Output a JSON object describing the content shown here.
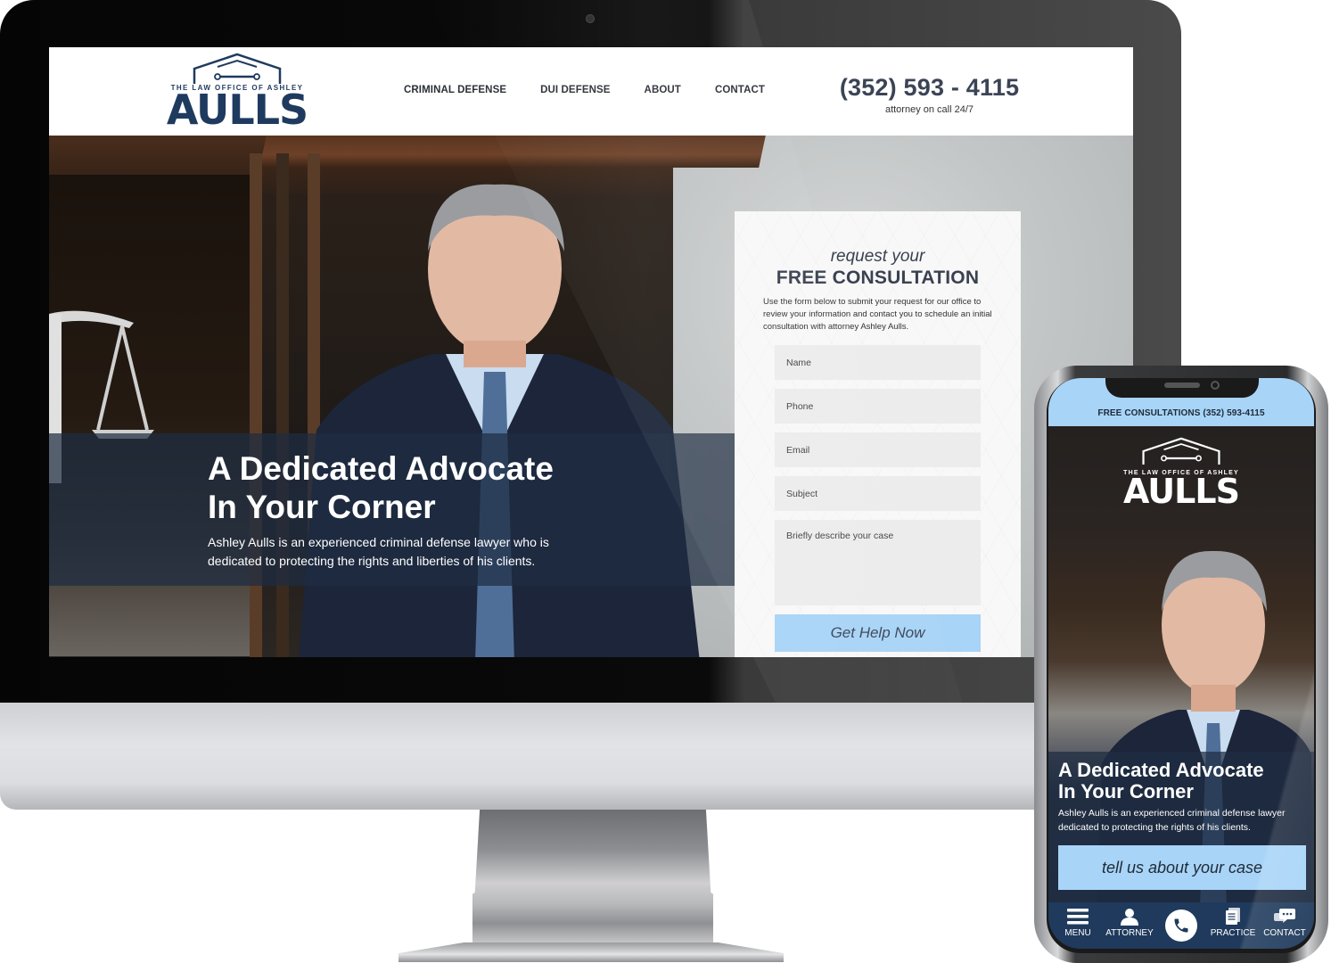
{
  "desktop": {
    "logo": {
      "tagline": "THE LAW OFFICE OF ASHLEY",
      "name": "AULLS"
    },
    "nav": [
      {
        "label": "CRIMINAL DEFENSE"
      },
      {
        "label": "DUI DEFENSE"
      },
      {
        "label": "ABOUT"
      },
      {
        "label": "CONTACT"
      }
    ],
    "phone": {
      "number": "(352) 593 - 4115",
      "subtitle": "attorney on call 24/7"
    },
    "hero": {
      "title_line1": "A Dedicated Advocate",
      "title_line2": "In Your Corner",
      "text": "Ashley Aulls is an experienced criminal defense lawyer who is dedicated to protecting the rights and liberties of his clients."
    },
    "form": {
      "kicker": "request your",
      "title": "FREE CONSULTATION",
      "description": "Use the form below to submit your request for our office to review your information and contact you to schedule an initial consultation with attorney Ashley Aulls.",
      "fields": [
        {
          "placeholder": "Name",
          "value": ""
        },
        {
          "placeholder": "Phone",
          "value": ""
        },
        {
          "placeholder": "Email",
          "value": ""
        },
        {
          "placeholder": "Subject",
          "value": ""
        }
      ],
      "textarea": {
        "placeholder": "Briefly describe your case",
        "value": ""
      },
      "submit_label": "Get Help Now"
    }
  },
  "mobile": {
    "topbar": "FREE CONSULTATIONS (352) 593-4115",
    "logo": {
      "tagline": "THE LAW OFFICE OF ASHLEY",
      "name": "AULLS"
    },
    "hero": {
      "title_line1": "A Dedicated Advocate",
      "title_line2": "In Your Corner",
      "text": "Ashley Aulls is an experienced criminal defense lawyer dedicated to protecting the rights of his clients.",
      "cta_label": "tell us about your case"
    },
    "bottom_nav": [
      {
        "label": "MENU",
        "icon": "menu-icon"
      },
      {
        "label": "ATTORNEY",
        "icon": "person-icon"
      },
      {
        "label": "",
        "icon": "phone-icon"
      },
      {
        "label": "PRACTICE",
        "icon": "documents-icon"
      },
      {
        "label": "CONTACT",
        "icon": "chat-icon"
      }
    ]
  },
  "colors": {
    "brand_navy": "#1f3a5f",
    "accent_light_blue": "#a8d4f7",
    "text_dark": "#3a4150",
    "mobile_nav_bg": "#1f3a5c"
  }
}
